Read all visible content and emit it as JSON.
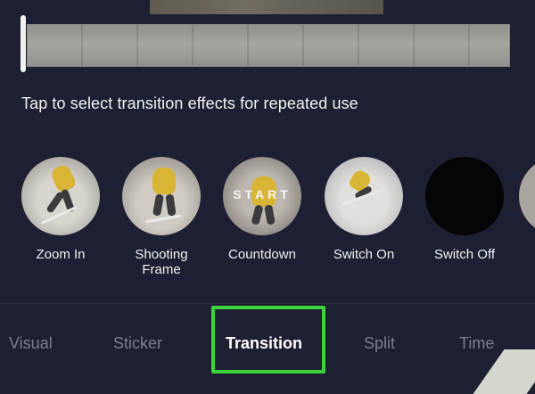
{
  "hint_text": "Tap to select transition effects for repeated use",
  "effects": [
    {
      "label": "Zoom In",
      "icon": "zoom-in-thumb"
    },
    {
      "label": "Shooting Frame",
      "icon": "shooting-frame-thumb"
    },
    {
      "label": "Countdown",
      "icon": "countdown-thumb",
      "overlay_text": "START"
    },
    {
      "label": "Switch On",
      "icon": "switch-on-thumb"
    },
    {
      "label": "Switch Off",
      "icon": "switch-off-thumb"
    }
  ],
  "tabs": [
    {
      "label": "Visual",
      "active": false
    },
    {
      "label": "Sticker",
      "active": false
    },
    {
      "label": "Transition",
      "active": true
    },
    {
      "label": "Split",
      "active": false
    },
    {
      "label": "Time",
      "active": false
    }
  ],
  "colors": {
    "background": "#1d1f32",
    "highlight": "#3ed43e",
    "active_tab": "#ffffff",
    "inactive_tab": "#7d7f8f"
  }
}
